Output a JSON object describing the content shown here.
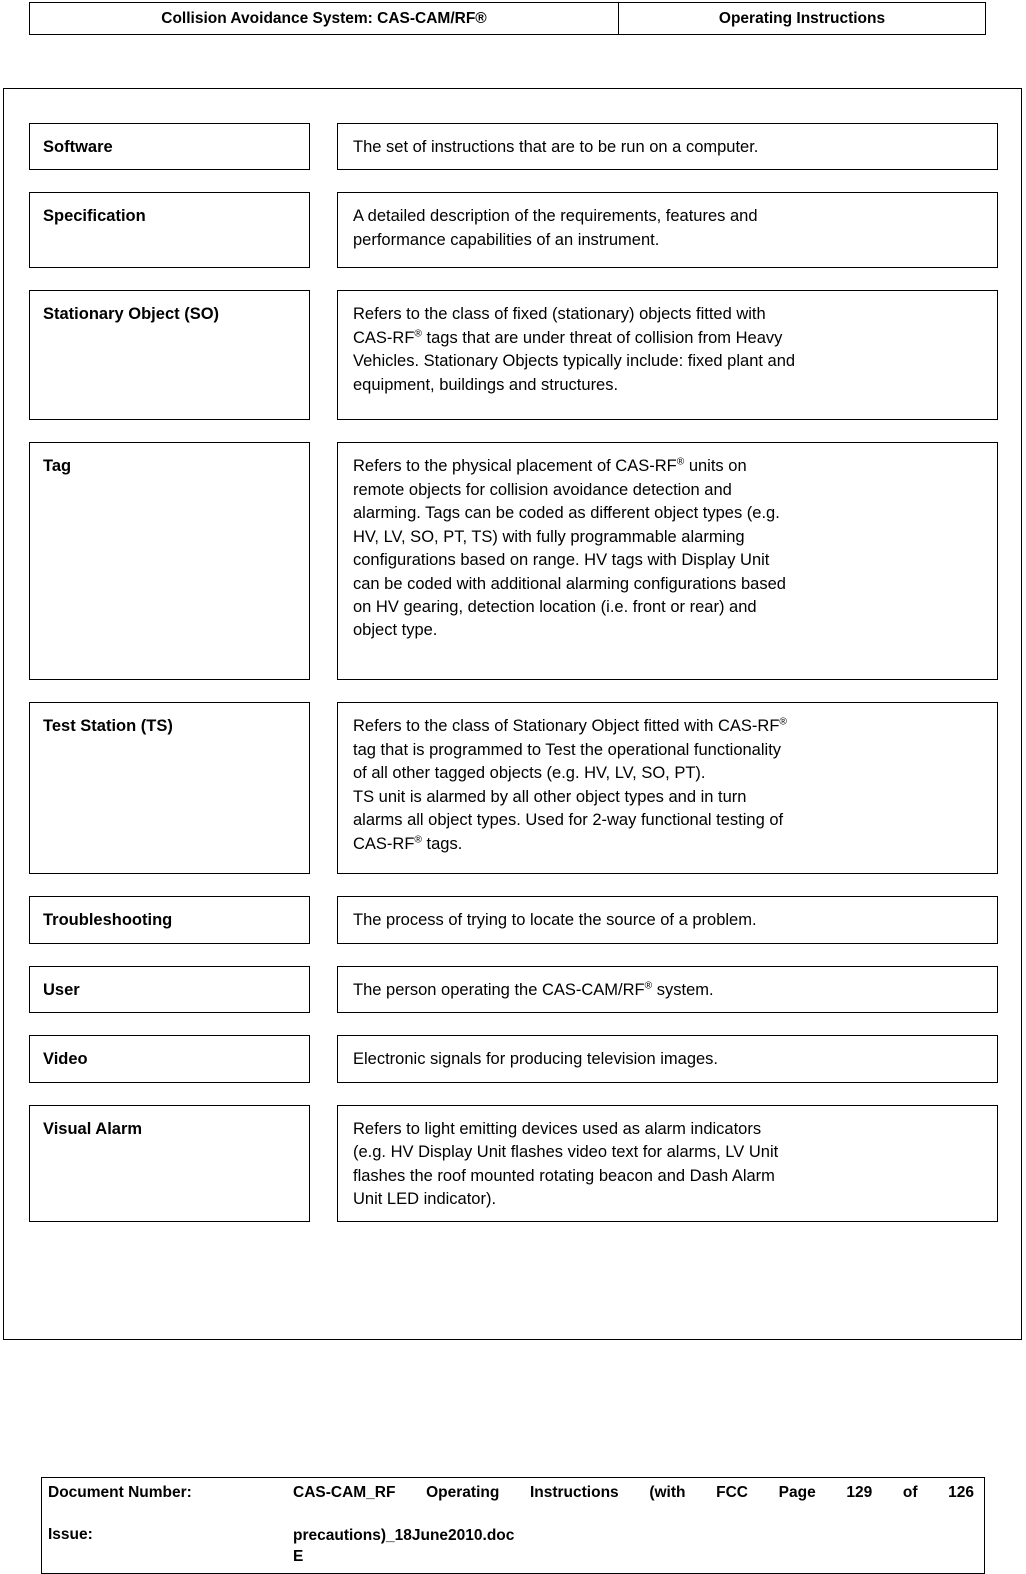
{
  "header": {
    "left_title": "Collision Avoidance System: CAS-CAM/RF®",
    "right_title": "Operating Instructions"
  },
  "glossary": {
    "entries": [
      {
        "term": "Software",
        "definition": "The set of instructions that are to be run on a computer.",
        "lines": [
          "The set of instructions that are to be run on a computer."
        ]
      },
      {
        "term": "Specification",
        "definition": "A detailed description of the requirements, features and performance capabilities of an instrument.",
        "lines": [
          "A detailed description of the requirements, features and",
          "performance capabilities of an instrument."
        ]
      },
      {
        "term": "Stationary Object (SO)",
        "definition": "Refers to the class of fixed (stationary) objects fitted with CAS-RF® tags that are under threat of collision from Heavy Vehicles. Stationary Objects typically include: fixed plant and equipment, buildings and structures.",
        "lines": [
          "Refers to the class of fixed (stationary) objects fitted with",
          "CAS-RF® tags that are under threat of collision from Heavy",
          "Vehicles. Stationary Objects typically include: fixed plant and",
          "equipment, buildings and structures."
        ]
      },
      {
        "term": "Tag",
        "definition": "Refers to the physical placement of CAS-RF® units on remote objects for collision avoidance detection and alarming.  Tags can be coded as different object types (e.g. HV, LV, SO, PT, TS) with fully programmable alarming configurations based on range. HV tags with Display Unit can be coded with additional alarming configurations based on HV gearing, detection location (i.e. front or rear) and object type.",
        "lines": [
          "Refers to the physical placement of CAS-RF® units on",
          "remote objects for collision avoidance detection and",
          "alarming.  Tags can be coded as different object types (e.g.",
          "HV, LV, SO, PT, TS) with fully programmable alarming",
          "configurations based on range. HV tags with Display Unit",
          "can be coded with additional alarming configurations based",
          "on HV gearing, detection location (i.e. front or rear) and",
          "object type."
        ]
      },
      {
        "term": "Test Station (TS)",
        "definition": "Refers to the class of Stationary Object fitted with CAS-RF® tag that is programmed to Test the operational functionality of all other tagged objects (e.g. HV, LV, SO, PT). TS unit is alarmed by all other object types and in turn alarms all object types. Used for 2-way functional testing of CAS-RF® tags.",
        "lines": [
          "Refers to the class of Stationary Object fitted with CAS-RF®",
          "tag that is programmed to Test the operational functionality",
          "of all other tagged objects (e.g. HV, LV, SO, PT).",
          "TS unit is alarmed by all other object types and in turn",
          "alarms all object types. Used for 2-way functional testing of",
          "CAS-RF® tags."
        ]
      },
      {
        "term": "Troubleshooting",
        "definition": "The process of trying to locate the source of a problem.",
        "lines": [
          "The process of trying to locate the source of a problem."
        ]
      },
      {
        "term": "User",
        "definition": "The person operating the CAS-CAM/RF® system.",
        "lines": [
          "The person operating the CAS-CAM/RF® system."
        ]
      },
      {
        "term": "Video",
        "definition": "Electronic signals for producing television images.",
        "lines": [
          "Electronic signals for producing television images."
        ]
      },
      {
        "term": "Visual Alarm",
        "definition": "Refers to light emitting devices used as alarm indicators (e.g. HV Display Unit flashes video text for alarms, LV Unit flashes the roof mounted rotating beacon and Dash Alarm Unit LED indicator).",
        "lines": [
          "Refers to light emitting devices used as alarm indicators",
          "(e.g. HV Display Unit flashes video text for alarms, LV Unit",
          "flashes the roof mounted rotating beacon and Dash Alarm",
          "Unit LED indicator)."
        ]
      }
    ]
  },
  "footer": {
    "document_number_label": "Document Number:",
    "issue_label": "Issue:",
    "document_number_line1": "CAS-CAM_RF Operating Instructions (with FCC Page 129 of 126",
    "document_number_line2": "precautions)_18June2010.doc",
    "issue_value": "E",
    "page_current": "129",
    "page_total": "126",
    "page_text": "Page 129 of 126"
  }
}
